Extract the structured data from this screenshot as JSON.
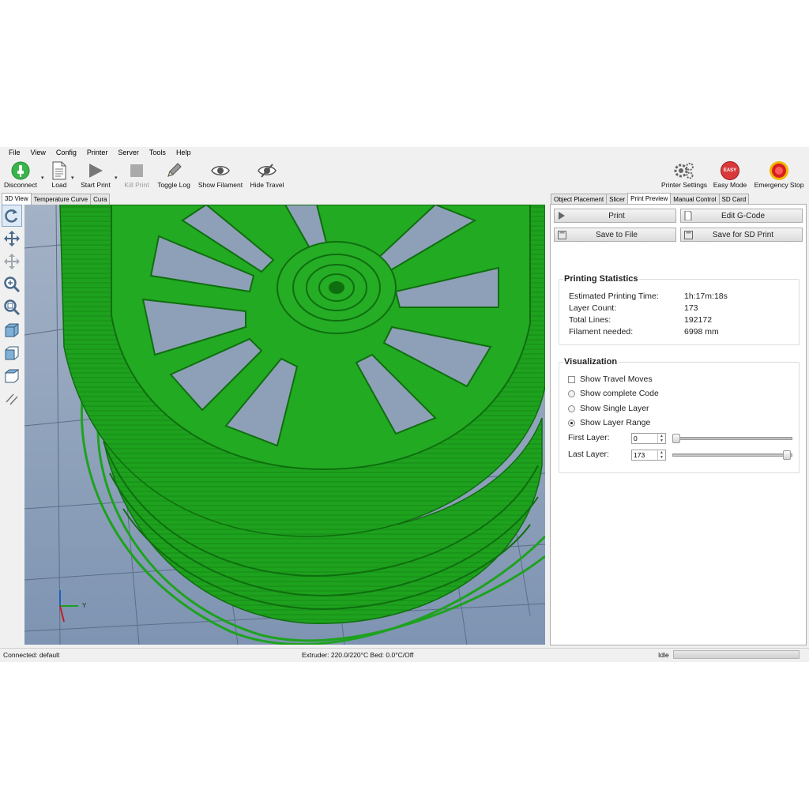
{
  "menu": [
    "File",
    "View",
    "Config",
    "Printer",
    "Server",
    "Tools",
    "Help"
  ],
  "toolbar": {
    "disconnect": "Disconnect",
    "load": "Load",
    "start_print": "Start Print",
    "kill_print": "Kill Print",
    "toggle_log": "Toggle Log",
    "show_filament": "Show Filament",
    "hide_travel": "Hide Travel",
    "printer_settings": "Printer Settings",
    "easy_mode": "Easy Mode",
    "easy_badge": "EASY",
    "emergency_stop": "Emergency Stop"
  },
  "left_tabs": [
    "3D View",
    "Temperature Curve",
    "Cura"
  ],
  "left_tabs_active": 0,
  "right_tabs": [
    "Object Placement",
    "Slicer",
    "Print Preview",
    "Manual Control",
    "SD Card"
  ],
  "right_tabs_active": 2,
  "left_tools": [
    "rotate-icon",
    "move-icon",
    "move-object-icon",
    "zoom-icon",
    "fit-icon",
    "iso-view-icon",
    "front-view-icon",
    "top-view-icon",
    "parallel-lines-icon"
  ],
  "actions": {
    "print": "Print",
    "edit_gcode": "Edit G-Code",
    "save_to_file": "Save to File",
    "save_sd": "Save for SD Print"
  },
  "stats": {
    "title": "Printing Statistics",
    "rows": [
      {
        "label": "Estimated Printing Time:",
        "value": "1h:17m:18s"
      },
      {
        "label": "Layer Count:",
        "value": "173"
      },
      {
        "label": "Total Lines:",
        "value": "192172"
      },
      {
        "label": "Filament needed:",
        "value": "6998 mm"
      }
    ]
  },
  "visualization": {
    "title": "Visualization",
    "show_travel": "Show Travel Moves",
    "show_travel_checked": false,
    "show_complete": "Show complete Code",
    "show_single": "Show Single Layer",
    "show_range": "Show Layer Range",
    "selected": "show_range",
    "first_layer_label": "First Layer:",
    "first_layer_value": "0",
    "last_layer_label": "Last Layer:",
    "last_layer_value": "173",
    "first_slider_fraction": 0.0,
    "last_slider_fraction": 1.0
  },
  "axes": {
    "y": "Y"
  },
  "colors": {
    "model": "#1fa51f",
    "floor": "#8aa0bb",
    "accent": "#2a9b2a"
  },
  "status": {
    "connection": "Connected: default",
    "temps": "Extruder: 220.0/220°C Bed: 0.0°C/Off",
    "state": "Idle"
  }
}
